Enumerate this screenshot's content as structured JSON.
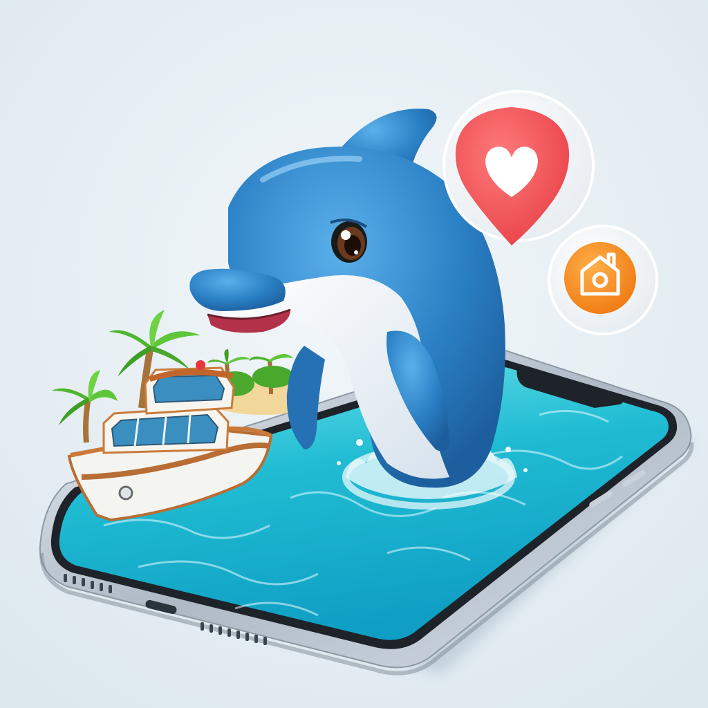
{
  "scene": {
    "background": "#e3edf2",
    "subjects": [
      "smartphone",
      "dolphin",
      "boat",
      "palm-island",
      "heart-pin",
      "home-badge"
    ]
  },
  "icons": {
    "heart_pin": "heart-location-pin-icon",
    "home_badge": "home-icon"
  },
  "colors": {
    "dolphin_blue": "#2a7fc4",
    "dolphin_belly": "#eef3f7",
    "water": "#28c3d6",
    "heart_pin": "#f2575b",
    "home_badge": "#f58a1f",
    "phone_frame": "#b9c4cf",
    "palm_green": "#4fb52e"
  }
}
